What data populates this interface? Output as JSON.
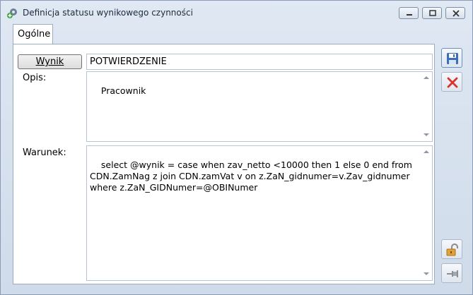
{
  "window": {
    "title": "Definicja statusu wynikowego czynności",
    "icons": {
      "app": "gear-plus-icon",
      "minimize": "minimize-icon",
      "maximize": "maximize-icon",
      "close": "close-icon"
    }
  },
  "tabs": [
    {
      "label": "Ogólne",
      "active": true
    }
  ],
  "form": {
    "wynik_button_label": "Wynik",
    "wynik_value": "POTWIERDZENIE",
    "opis_label": "Opis:",
    "opis_value": "Pracownik",
    "warunek_label": "Warunek:",
    "warunek_value": "select @wynik = case when zav_netto <10000 then 1 else 0 end from CDN.ZamNag z join CDN.zamVat v on z.ZaN_gidnumer=v.Zav_gidnumer where z.ZaN_GIDNumer=@OBINumer"
  },
  "toolbar": {
    "save_icon": "save-icon",
    "cancel_icon": "cancel-icon",
    "lock_icon": "lock-icon",
    "pin_icon": "pin-icon"
  },
  "colors": {
    "accent": "#3a6fb7",
    "cancel": "#d8342c"
  }
}
